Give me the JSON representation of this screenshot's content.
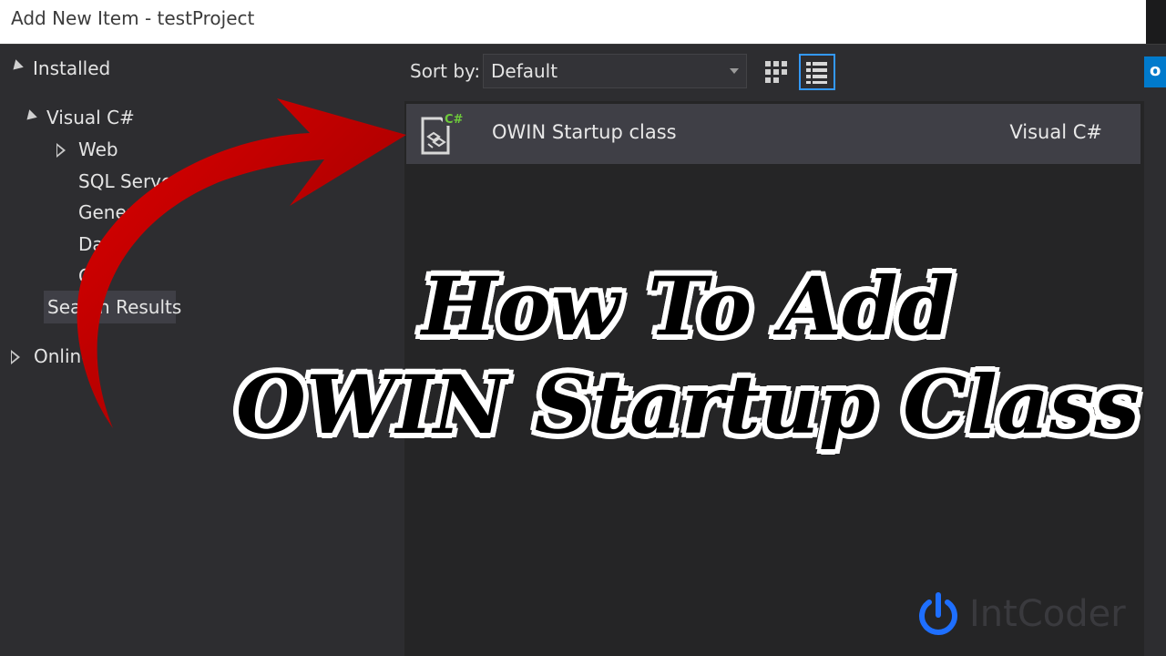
{
  "window": {
    "title": "Add New Item - testProject"
  },
  "tree": {
    "installed": "Installed",
    "visual_csharp": "Visual C#",
    "web": "Web",
    "sql_server": "SQL Server",
    "general": "General",
    "data": "Data",
    "code": "C",
    "search_results": "Search Results",
    "online": "Online"
  },
  "toolbar": {
    "sort_label": "Sort by:",
    "sort_value": "Default",
    "grid_view_icon": "grid-view-icon",
    "list_view_icon": "list-view-icon"
  },
  "right_panel": {
    "search_fragment": "o"
  },
  "templates": [
    {
      "name": "OWIN Startup class",
      "language": "Visual C#",
      "icon": "csharp-class-file-icon",
      "badge": "C#"
    }
  ],
  "overlay": {
    "line1": "How To Add",
    "line2": "OWIN Startup Class"
  },
  "watermark": {
    "text": "IntCoder",
    "icon": "power-icon"
  },
  "colors": {
    "accent": "#3399ff",
    "arrow": "#c40000",
    "badge": "#6ecb3b"
  }
}
